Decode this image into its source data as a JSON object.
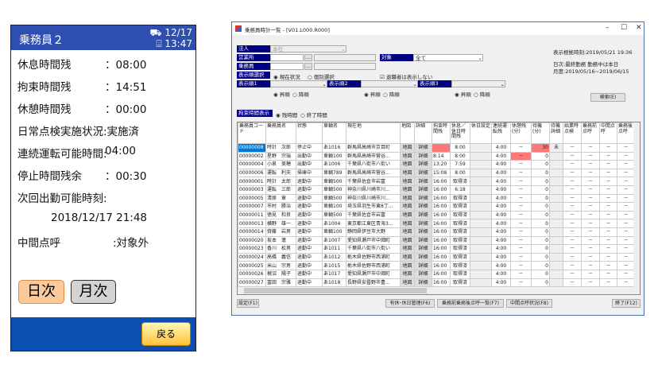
{
  "phone": {
    "title": "乗務員２",
    "date": "12/17",
    "time": "13:47",
    "rows": [
      {
        "label": "休息時間残",
        "value": "：08:00"
      },
      {
        "label": "拘束時間残",
        "value": "：14:51"
      },
      {
        "label": "休憩時間残",
        "value": "：00:00"
      },
      {
        "label": "日常点検実施状況:実施済",
        "value": ""
      },
      {
        "label": "連続運転可能時間:",
        "value": "04:00"
      },
      {
        "label": "停止時間残余",
        "value": "：00:30"
      },
      {
        "label": "次回出勤可能時刻:",
        "value": ""
      },
      {
        "label": "2018/12/17 21:48",
        "value": ""
      },
      {
        "label": "中間点呼",
        "value": ":対象外"
      }
    ],
    "day_button": "日次",
    "month_button": "月次",
    "back_button": "戻る"
  },
  "window": {
    "title": "乗務員時計一覧 - [V01.L000.R000]",
    "labels": {
      "corp": "法人",
      "office": "営業所",
      "target": "対象",
      "crew": "乗務員",
      "order_sel": "表示順選択",
      "order1": "表示順1",
      "order2": "表示順2",
      "order3": "表示順3",
      "bind": "拘束時間表示"
    },
    "corp_value": "本社",
    "target_value": "全て",
    "radio_current": "現在状況",
    "radio_individual": "個別選択",
    "hide_retired": "退職者は表示しない",
    "asc": "昇順",
    "desc": "降順",
    "remaining": "残時間",
    "end_time": "終了時間",
    "info1": "表示根拠時刻:2019/05/21 19:36",
    "info2": "日次:最終勤務 勤務中は本日",
    "info3": "月度:2019/05/16~2019/06/15",
    "search_button": "検索(E)",
    "columns": [
      "乗務員コード",
      "乗務員名",
      "状態",
      "車輌名",
      "現在地",
      "地図",
      "詳細",
      "拘束時間残",
      "休息／休日時間残",
      "休日設定",
      "連続運転残",
      "休憩残(分)",
      "待機(分)",
      "待機詳細",
      "始業時点検",
      "乗務前点呼",
      "中間点呼",
      "乗務後点呼"
    ],
    "rows": [
      [
        "00000008",
        "時計　次郎",
        "停止中",
        "あ1016",
        "群馬県高崎市京目町",
        "",
        "8:00",
        "4:00",
        "－",
        "30",
        "未"
      ],
      [
        "00000002",
        "星野　宗瑞",
        "出勤中",
        "車輌100",
        "群馬県高崎市菅谷...",
        "8:14",
        "8:00",
        "4:00",
        "－",
        "0",
        ""
      ],
      [
        "00000004",
        "小泉　美穂",
        "出勤中",
        "あ1006",
        "千葉県八街市八街い",
        "13:20",
        "7:59",
        "4:00",
        "－",
        "0",
        ""
      ],
      [
        "00000006",
        "運転　利夫",
        "帰庫中",
        "車輌789",
        "群馬県高崎市菅谷...",
        "15:08",
        "8:00",
        "4:00",
        "－",
        "0",
        ""
      ],
      [
        "00000001",
        "時計　太郎",
        "退勤中",
        "車輌500",
        "千葉県佐倉市岩富",
        "16:00",
        "取得済",
        "4:00",
        "－",
        "0",
        ""
      ],
      [
        "00000003",
        "運転　三郎",
        "退勤中",
        "車輌500",
        "神奈川県川崎市川...",
        "16:00",
        "6:18",
        "4:00",
        "－",
        "0",
        ""
      ],
      [
        "00000005",
        "清原　章",
        "退勤中",
        "車輌500",
        "神奈川県川崎市川...",
        "16:00",
        "取得済",
        "4:00",
        "－",
        "0",
        ""
      ],
      [
        "00000007",
        "市村　勝治",
        "退勤中",
        "車輌100",
        "埼玉県羽生市東8丁...",
        "16:00",
        "取得済",
        "4:00",
        "－",
        "0",
        ""
      ],
      [
        "00000011",
        "徳見　和良",
        "退勤中",
        "車輌500",
        "千葉県佐倉市岩富",
        "16:00",
        "取得済",
        "4:00",
        "－",
        "0",
        ""
      ],
      [
        "00000013",
        "横野　雄一",
        "退勤中",
        "あ1004",
        "東京都江東区青海3...",
        "16:00",
        "取得済",
        "4:00",
        "－",
        "0",
        ""
      ],
      [
        "00000014",
        "齊藤　岩男",
        "退勤中",
        "車輌100",
        "静岡県伊豆市大野",
        "16:00",
        "取得済",
        "4:00",
        "－",
        "0",
        ""
      ],
      [
        "00000020",
        "坂本　蓮",
        "退勤中",
        "あ1007",
        "愛知県瀬戸市中畑町",
        "16:00",
        "取得済",
        "4:00",
        "－",
        "0",
        ""
      ],
      [
        "00000023",
        "香川　松男",
        "退勤中",
        "あ1011",
        "千葉県八街市八街い",
        "16:00",
        "取得済",
        "4:00",
        "－",
        "0",
        ""
      ],
      [
        "00000024",
        "高橋　義信",
        "退勤中",
        "あ1012",
        "栃木県佐野市西浦町",
        "16:00",
        "取得済",
        "4:00",
        "－",
        "0",
        ""
      ],
      [
        "00000025",
        "米山　宗男",
        "退勤中",
        "あ1015",
        "栃木県佐野市西浦町",
        "16:00",
        "取得済",
        "4:00",
        "－",
        "0",
        ""
      ],
      [
        "00000026",
        "梶沼　陽子",
        "退勤中",
        "あ1017",
        "愛知県瀬戸市中畑町",
        "16:00",
        "取得済",
        "4:00",
        "－",
        "0",
        ""
      ],
      [
        "00000027",
        "冨田　宗雅",
        "退勤中",
        "あ1018",
        "長野県安曇野市豊...",
        "16:00",
        "取得済",
        "4:00",
        "－",
        "0",
        ""
      ]
    ],
    "map_label": "地図",
    "detail_label": "詳細",
    "dash": "－",
    "buttons": {
      "settings": "設定(F1)",
      "holiday": "有休･休日管理(F6)",
      "rollcall": "乗務前乗務後点呼一覧(F7)",
      "midcall": "中間点呼状況(F8)",
      "exit": "終了(F12)"
    },
    "highlight_color": "#ff7777"
  }
}
